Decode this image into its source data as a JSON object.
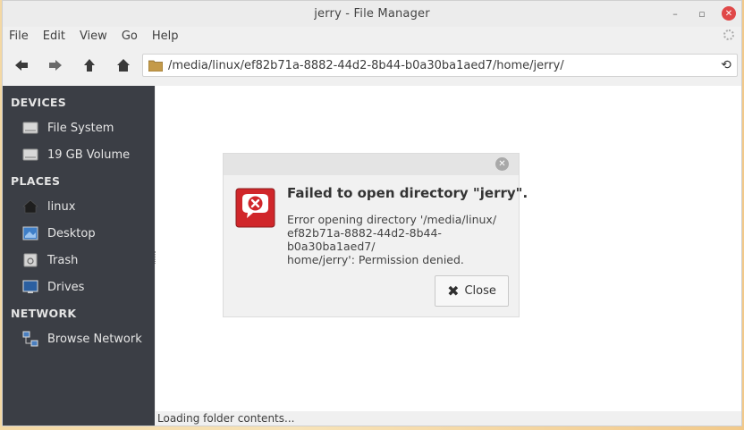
{
  "window": {
    "title": "jerry - File Manager",
    "controls": {
      "minimize": "–",
      "restore": "▫",
      "close": "✕"
    }
  },
  "menubar": {
    "items": [
      "File",
      "Edit",
      "View",
      "Go",
      "Help"
    ]
  },
  "toolbar": {
    "buttons": [
      "back-icon",
      "forward-icon",
      "up-icon",
      "home-icon"
    ],
    "path": "/media/linux/ef82b71a-8882-44d2-8b44-b0a30ba1aed7/home/jerry/"
  },
  "sidebar": {
    "devices_heading": "DEVICES",
    "devices": [
      {
        "label": "File System",
        "icon": "drive-icon"
      },
      {
        "label": "19 GB Volume",
        "icon": "drive-icon"
      }
    ],
    "places_heading": "PLACES",
    "places": [
      {
        "label": "linux",
        "icon": "home-icon"
      },
      {
        "label": "Desktop",
        "icon": "desktop-icon"
      },
      {
        "label": "Trash",
        "icon": "trash-icon"
      },
      {
        "label": "Drives",
        "icon": "computer-icon"
      }
    ],
    "network_heading": "NETWORK",
    "network": [
      {
        "label": "Browse Network",
        "icon": "network-icon"
      }
    ]
  },
  "statusbar": {
    "text": "Loading folder contents..."
  },
  "dialog": {
    "heading": "Failed to open directory \"jerry\".",
    "message": "Error opening directory '/media/linux/ef82b71a-8882-44d2-8b44-b0a30ba1aed7/home/jerry': Permission denied.",
    "message_lines": [
      "Error opening directory '/media/linux/",
      "ef82b71a-8882-44d2-8b44-b0a30ba1aed7/",
      "home/jerry': Permission denied."
    ],
    "close_label": "Close",
    "icon": "error-icon"
  },
  "colors": {
    "sidebar_bg": "#3b3e45",
    "error_red": "#d0262a",
    "close_button": "#e04848"
  }
}
